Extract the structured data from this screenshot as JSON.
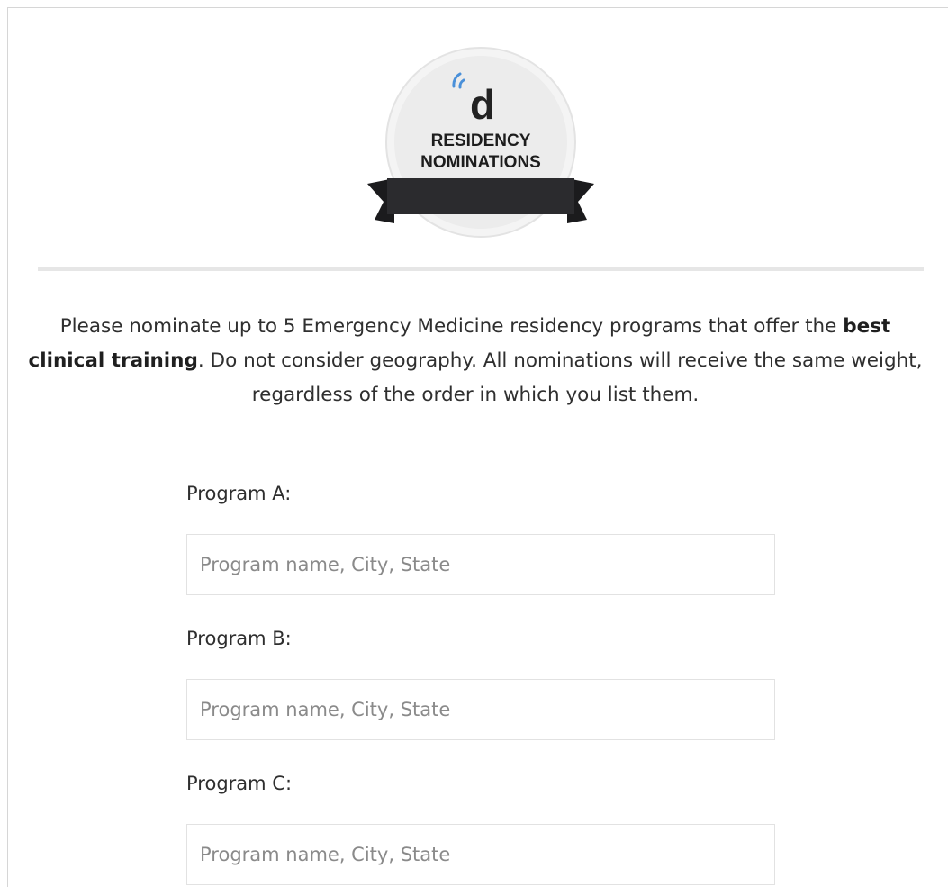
{
  "logo": {
    "letter": "d",
    "line1": "RESIDENCY",
    "line2": "NOMINATIONS",
    "accent": "#4a90d9",
    "ribbon": "#2b2b2e"
  },
  "intro": {
    "part1": "Please nominate up to 5 Emergency Medicine residency programs that offer the ",
    "bold": "best clinical training",
    "part2": ". Do not consider geography. All nominations will receive the same weight, regardless of the order in which you list them."
  },
  "programs": [
    {
      "label": "Program A:",
      "value": "",
      "placeholder": "Program name, City, State"
    },
    {
      "label": "Program B:",
      "value": "",
      "placeholder": "Program name, City, State"
    },
    {
      "label": "Program C:",
      "value": "",
      "placeholder": "Program name, City, State"
    }
  ]
}
